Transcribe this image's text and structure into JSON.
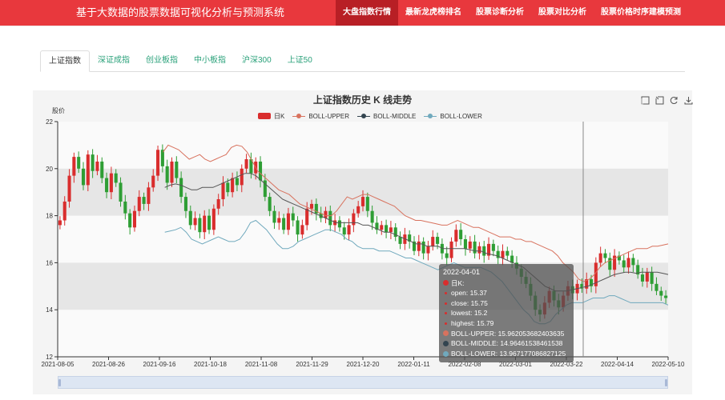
{
  "header": {
    "brand": "基于大数据的股票数据可视化分析与预测系统",
    "nav": [
      {
        "label": "大盘指数行情",
        "active": true
      },
      {
        "label": "最新龙虎榜排名",
        "active": false
      },
      {
        "label": "股票诊断分析",
        "active": false
      },
      {
        "label": "股票对比分析",
        "active": false
      },
      {
        "label": "股票价格时序建模预测",
        "active": false
      }
    ]
  },
  "tabs": [
    {
      "label": "上证指数",
      "active": true
    },
    {
      "label": "深证成指",
      "active": false
    },
    {
      "label": "创业板指",
      "active": false
    },
    {
      "label": "中小板指",
      "active": false
    },
    {
      "label": "沪深300",
      "active": false
    },
    {
      "label": "上证50",
      "active": false
    }
  ],
  "colors": {
    "up": "#d92d2d",
    "down": "#2e9e34",
    "upper": "#d8725e",
    "middle": "#555555",
    "lower": "#70a9bd",
    "header": "#e8383d"
  },
  "chart_data": {
    "type": "candlestick",
    "title": "上证指数历史 K 线走势",
    "ylabel": "股价",
    "ylim": [
      12,
      22
    ],
    "yticks": [
      12,
      14,
      16,
      18,
      20,
      22
    ],
    "xticks": [
      "2021-08-05",
      "2021-08-26",
      "2021-09-16",
      "2021-10-18",
      "2021-11-08",
      "2021-11-29",
      "2021-12-20",
      "2022-01-11",
      "2022-02-08",
      "2022-03-01",
      "2022-03-22",
      "2022-04-14",
      "2022-05-10"
    ],
    "legend": [
      "日K",
      "BOLL-UPPER",
      "BOLL-MIDDLE",
      "BOLL-LOWER"
    ],
    "legend_position": "top-center",
    "toolbox_icons": [
      "zoom-icon",
      "zoom-reset-icon",
      "restore-icon",
      "download-icon"
    ],
    "close": [
      17.8,
      18.6,
      19.7,
      20.5,
      20.0,
      19.3,
      20.6,
      19.9,
      20.3,
      19.6,
      19.0,
      19.8,
      19.4,
      18.6,
      18.1,
      17.5,
      18.2,
      18.8,
      18.5,
      19.2,
      19.7,
      20.8,
      20.1,
      19.4,
      20.3,
      19.6,
      18.8,
      18.2,
      17.6,
      17.9,
      17.3,
      18.0,
      17.4,
      18.3,
      18.7,
      19.4,
      19.0,
      19.6,
      19.3,
      20.0,
      20.4,
      19.8,
      20.3,
      19.5,
      18.8,
      18.2,
      17.7,
      17.9,
      17.4,
      18.1,
      17.8,
      17.2,
      17.6,
      18.3,
      18.5,
      18.1,
      17.9,
      18.2,
      17.6,
      17.8,
      17.5,
      17.2,
      17.6,
      18.1,
      18.4,
      18.8,
      18.2,
      17.7,
      17.4,
      17.6,
      17.3,
      17.5,
      17.1,
      16.8,
      17.2,
      16.9,
      16.5,
      16.9,
      16.4,
      16.7,
      17.1,
      16.8,
      16.4,
      16.2,
      16.9,
      17.4,
      17.0,
      16.6,
      16.9,
      16.4,
      16.7,
      16.3,
      16.8,
      16.5,
      16.2,
      16.5,
      16.3,
      16.0,
      15.75,
      15.4,
      15.1,
      14.6,
      14.0,
      13.8,
      14.3,
      14.8,
      14.4,
      14.1,
      14.6,
      15.0,
      14.7,
      15.1,
      14.9,
      15.3,
      15.0,
      16.0,
      16.4,
      16.2,
      15.7,
      16.3,
      16.1,
      15.8,
      16.2,
      15.9,
      15.5,
      15.2,
      15.6,
      15.1,
      14.8,
      14.6,
      14.5
    ],
    "upper": [
      null,
      null,
      null,
      null,
      null,
      null,
      null,
      null,
      null,
      null,
      null,
      null,
      null,
      null,
      null,
      null,
      null,
      null,
      null,
      null,
      20.7,
      21.0,
      20.9,
      20.8,
      20.6,
      20.4,
      20.5,
      20.6,
      20.4,
      20.3,
      20.4,
      20.5,
      20.6,
      20.9,
      21.0,
      20.95,
      20.7,
      20.3,
      19.9,
      19.7,
      19.5,
      19.3,
      19.1,
      19.0,
      18.9,
      18.7,
      18.5,
      18.4,
      18.3,
      18.2,
      18.1,
      18.0,
      18.0,
      18.2,
      18.5,
      18.8,
      18.7,
      18.8,
      18.9,
      18.9,
      18.8,
      18.7,
      18.6,
      18.5,
      18.4,
      18.2,
      18.0,
      17.9,
      17.8,
      17.8,
      17.75,
      17.7,
      17.65,
      17.6,
      17.6,
      17.7,
      17.8,
      17.7,
      17.6,
      17.5,
      17.5,
      17.4,
      17.3,
      17.2,
      17.1,
      17.1,
      17.1,
      17.0,
      17.0,
      16.9,
      16.9,
      16.8,
      16.7,
      16.6,
      16.5,
      16.3,
      16.0,
      15.8,
      15.6,
      15.3,
      15.2,
      15.3,
      15.5,
      15.8,
      16.0,
      16.1,
      16.2,
      16.3,
      16.4,
      16.5,
      16.6,
      16.6,
      16.6,
      16.7,
      16.7,
      16.75,
      16.8
    ],
    "middle": [
      null,
      null,
      null,
      null,
      null,
      null,
      null,
      null,
      null,
      null,
      null,
      null,
      null,
      null,
      null,
      null,
      null,
      null,
      null,
      null,
      19.2,
      19.3,
      19.35,
      19.3,
      19.2,
      19.1,
      19.1,
      19.2,
      19.2,
      19.2,
      19.3,
      19.4,
      19.5,
      19.6,
      19.7,
      19.8,
      19.8,
      19.7,
      19.5,
      19.3,
      19.1,
      18.9,
      18.7,
      18.6,
      18.5,
      18.4,
      18.3,
      18.2,
      18.1,
      18.0,
      17.9,
      17.8,
      17.7,
      17.7,
      17.7,
      17.7,
      17.7,
      17.6,
      17.6,
      17.5,
      17.4,
      17.3,
      17.3,
      17.2,
      17.1,
      17.0,
      16.9,
      16.8,
      16.8,
      16.7,
      16.7,
      16.7,
      16.6,
      16.6,
      16.6,
      16.6,
      16.6,
      16.55,
      16.5,
      16.5,
      16.4,
      16.35,
      16.3,
      16.2,
      16.1,
      16.0,
      15.9,
      15.8,
      15.6,
      15.4,
      15.2,
      15.0,
      14.9,
      14.8,
      14.8,
      14.8,
      14.85,
      14.9,
      14.95,
      15.0,
      15.1,
      15.2,
      15.3,
      15.4,
      15.5,
      15.55,
      15.6,
      15.6,
      15.55,
      15.6,
      15.6,
      15.6,
      15.6,
      15.55,
      15.5
    ],
    "lower": [
      null,
      null,
      null,
      null,
      null,
      null,
      null,
      null,
      null,
      null,
      null,
      null,
      null,
      null,
      null,
      null,
      null,
      null,
      null,
      null,
      17.3,
      17.35,
      17.4,
      17.5,
      17.3,
      17.0,
      16.9,
      16.8,
      16.9,
      17.0,
      17.1,
      17.0,
      16.9,
      16.9,
      17.0,
      17.3,
      17.7,
      17.8,
      17.6,
      17.4,
      17.1,
      16.8,
      16.6,
      16.6,
      16.7,
      16.9,
      17.0,
      17.1,
      17.2,
      17.3,
      17.4,
      17.4,
      17.3,
      17.2,
      17.0,
      16.9,
      16.7,
      16.6,
      16.6,
      16.6,
      16.5,
      16.5,
      16.5,
      16.4,
      16.3,
      16.2,
      16.2,
      16.1,
      16.0,
      15.9,
      15.8,
      15.7,
      15.8,
      15.9,
      16.0,
      15.9,
      15.8,
      15.8,
      15.8,
      15.8,
      15.7,
      15.6,
      15.4,
      15.2,
      14.9,
      14.6,
      14.3,
      14.0,
      13.8,
      13.5,
      13.4,
      13.4,
      13.5,
      13.8,
      14.0,
      14.2,
      14.3,
      14.3,
      14.3,
      14.4,
      14.5,
      14.5,
      14.5,
      14.6,
      14.6,
      14.5,
      14.4,
      14.3,
      14.3,
      14.3,
      14.3,
      14.3,
      14.3,
      14.3,
      14.2
    ]
  },
  "tooltip": {
    "date": "2022-04-01",
    "series": "日K:",
    "open": "open: 15.37",
    "close": "close: 15.75",
    "lowest": "lowest: 15.2",
    "highest": "highest: 15.79",
    "upper": "BOLL-UPPER: 15.962053682403635",
    "middle": "BOLL-MIDDLE: 14.96461538461538",
    "lower": "BOLL-LOWER: 13.967177086827125"
  }
}
